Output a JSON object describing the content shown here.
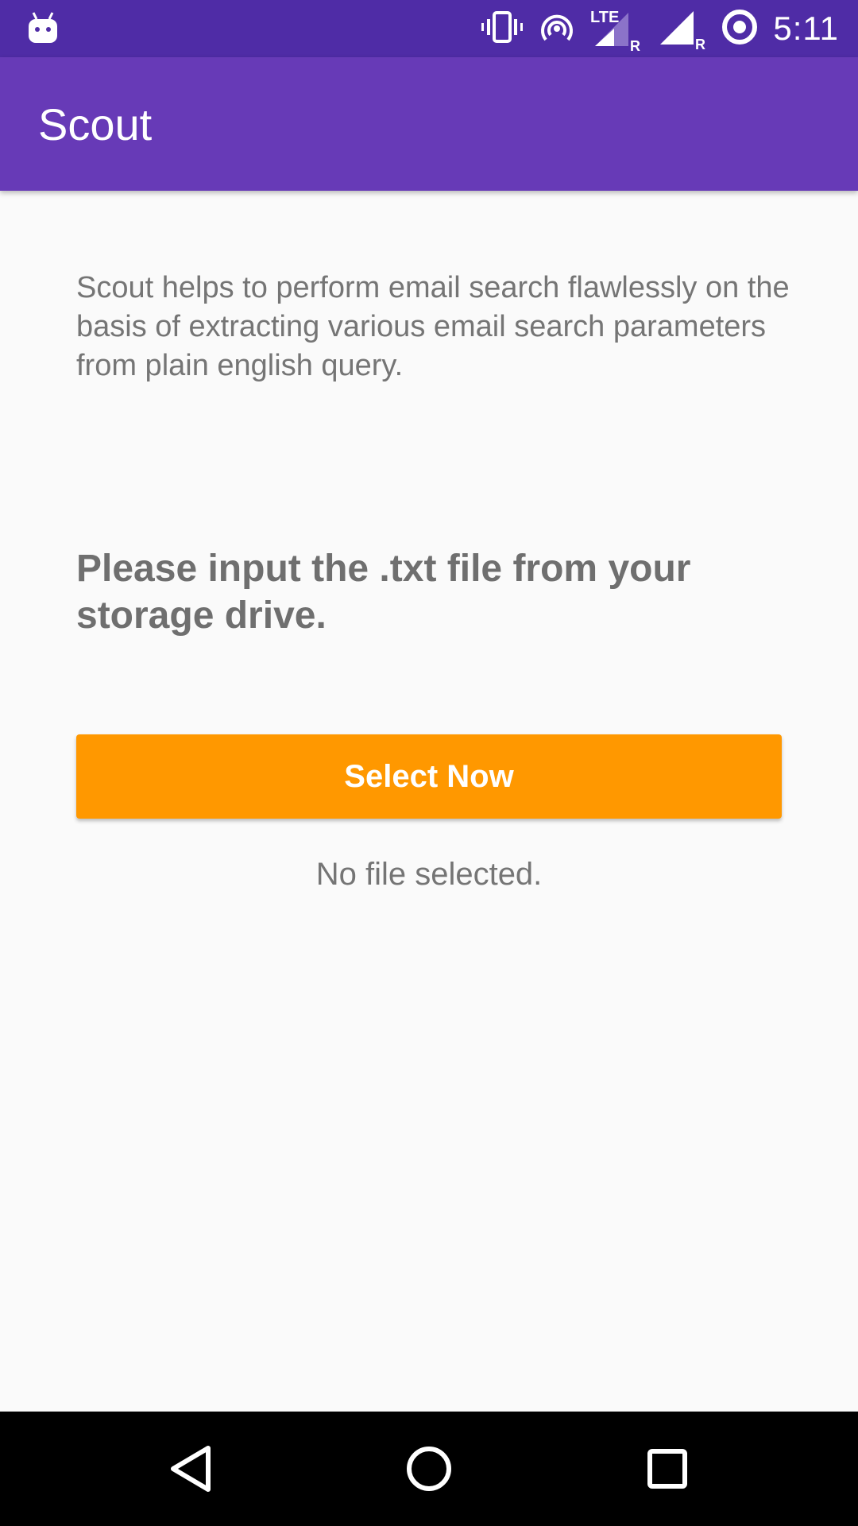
{
  "status_bar": {
    "time": "5:11",
    "network_label": "LTE",
    "roaming_label": "R",
    "icons": [
      "android-notification-icon",
      "vibrate-icon",
      "hotspot-icon",
      "signal-lte-roaming-icon",
      "signal-roaming-icon",
      "sync-icon"
    ]
  },
  "app_bar": {
    "title": "Scout",
    "color": "#673ab7"
  },
  "main": {
    "description": "Scout helps to perform email search flawlessly on the basis of extracting various email search parameters from plain english query.",
    "prompt": "Please input the .txt file from your storage drive.",
    "select_button_label": "Select Now",
    "select_button_color": "#ff9800",
    "file_status": "No file selected."
  },
  "nav_bar": {
    "icons": [
      "back-icon",
      "home-icon",
      "recents-icon"
    ]
  }
}
